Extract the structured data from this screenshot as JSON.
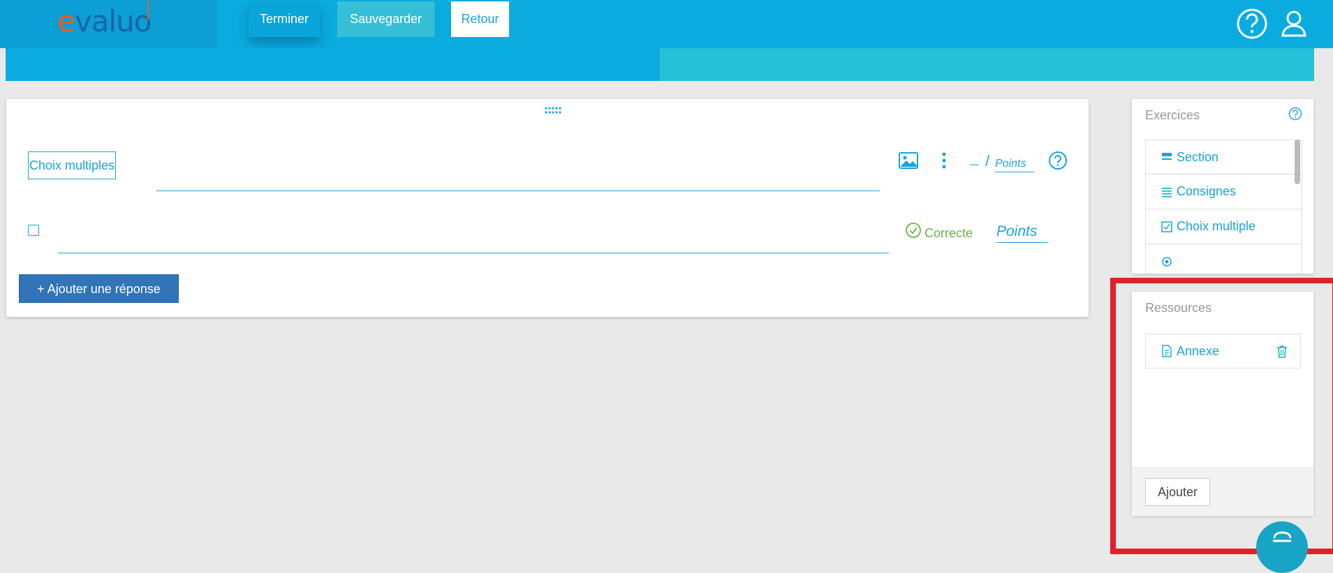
{
  "header": {
    "logo_text_e": "e",
    "logo_text_rest": "valuo",
    "buttons": {
      "terminer": "Terminer",
      "sauvegarder": "Sauvegarder",
      "retour": "Retour"
    },
    "icons": [
      "help-icon",
      "user-icon"
    ]
  },
  "question": {
    "type_label": "Choix multiples",
    "points_dots": "......",
    "points_slash": "/",
    "points_label": "Points",
    "answer": {
      "correct_label": "Correcte",
      "points_placeholder": "Points"
    },
    "add_answer_label": "+ Ajouter une réponse"
  },
  "exercises_panel": {
    "title": "Exercices",
    "items": [
      {
        "label": "Section",
        "icon": "section-icon"
      },
      {
        "label": "Consignes",
        "icon": "list-icon"
      },
      {
        "label": "Choix multiple",
        "icon": "checkbox-icon"
      }
    ]
  },
  "resources_panel": {
    "title": "Ressources",
    "items": [
      {
        "label": "Annexe",
        "icon": "document-icon"
      }
    ],
    "add_button": "Ajouter"
  },
  "colors": {
    "primary": "#0aace0",
    "accent_teal": "#25c1d9",
    "link_blue": "#1aa3d9",
    "button_blue": "#3174b7",
    "correct_green": "#6cb33f",
    "highlight_red": "#e12027"
  }
}
